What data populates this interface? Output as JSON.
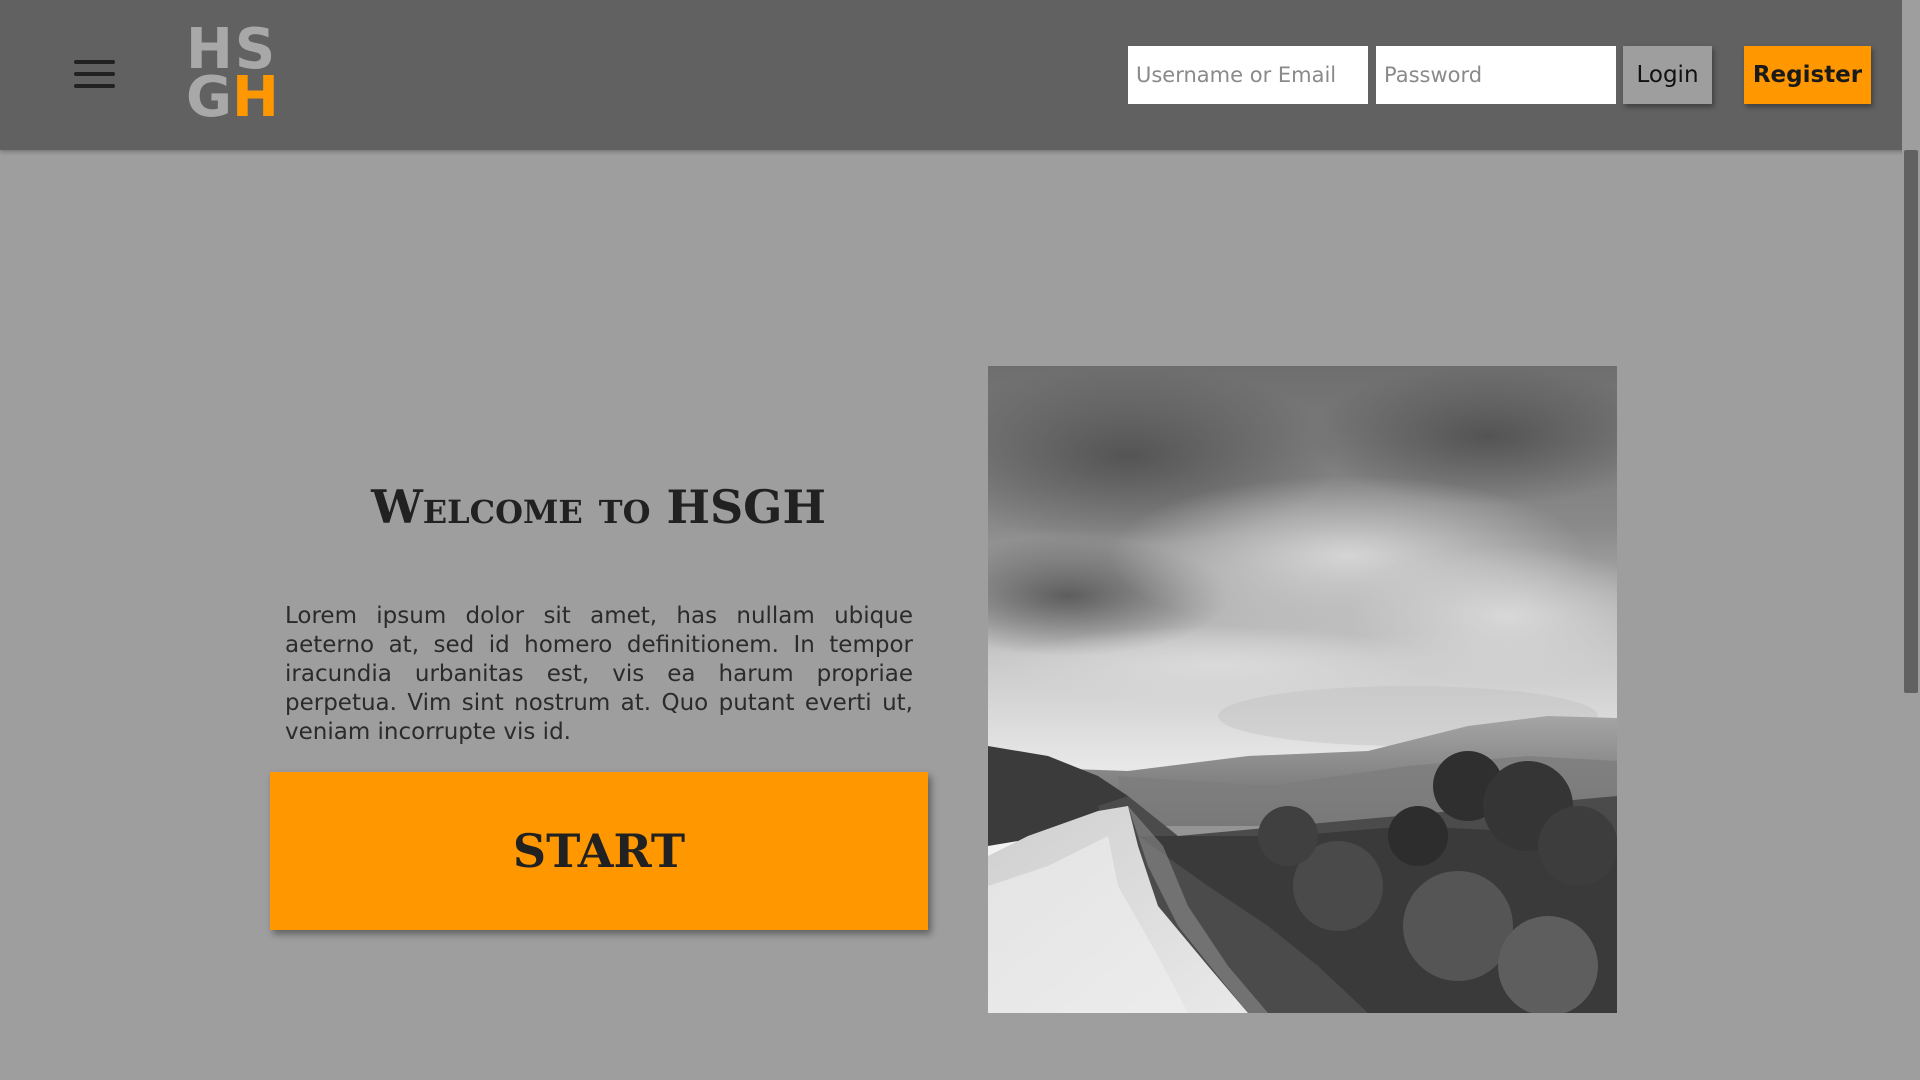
{
  "header": {
    "logo_letters": [
      "H",
      "S",
      "G",
      "H"
    ],
    "username_placeholder": "Username or Email",
    "password_placeholder": "Password",
    "login_label": "Login",
    "register_label": "Register"
  },
  "main": {
    "title": "Welcome to HSGH",
    "intro": "Lorem ipsum dolor sit amet, has nullam ubique aeterno at, sed id homero definitionem. In tempor iracundia urbanitas est, vis ea harum propriae perpetua. Vim sint nostrum at. Quo putant everti ut, veniam incorrupte vis id.",
    "start_label": "START"
  },
  "colors": {
    "accent": "#ff9800",
    "header_bg": "#616161",
    "page_bg": "#9e9e9e",
    "logo_gray": "#a8a8a8"
  },
  "icons": {
    "menu": "hamburger-menu-icon",
    "scroll_thumb": "scrollbar-thumb"
  }
}
